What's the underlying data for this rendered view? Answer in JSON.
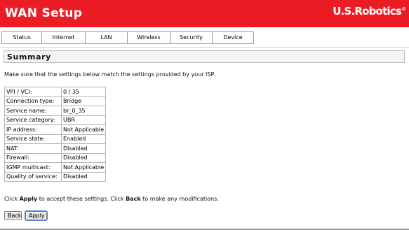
{
  "header": {
    "title": "WAN Setup",
    "brand": "U.S.Robotics",
    "brand_mark": "®",
    "background_color": "#ec1c24"
  },
  "nav": {
    "tabs": [
      "Status",
      "Internet",
      "LAN",
      "Wireless",
      "Security",
      "Device"
    ]
  },
  "section": {
    "title": "Summary"
  },
  "intro_text": "Make sure that the settings below match the settings provided by your ISP.",
  "settings": [
    {
      "label": "VPI / VCI:",
      "value": "0 / 35"
    },
    {
      "label": "Connection type:",
      "value": "Bridge"
    },
    {
      "label": "Service name:",
      "value": "br_0_35"
    },
    {
      "label": "Service category:",
      "value": "UBR"
    },
    {
      "label": "IP address:",
      "value": "Not Applicable"
    },
    {
      "label": "Service state:",
      "value": "Enabled"
    },
    {
      "label": "NAT:",
      "value": "Disabled"
    },
    {
      "label": "Firewall:",
      "value": "Disabled"
    },
    {
      "label": "IGMP multicast:",
      "value": "Not Applicable"
    },
    {
      "label": "Quality of service:",
      "value": "Disabled"
    }
  ],
  "apply_note": {
    "part1": "Click ",
    "apply_word": "Apply",
    "part2": " to accept these settings. Click ",
    "back_word": "Back",
    "part3": " to make any modifications."
  },
  "buttons": {
    "back_label": "Back",
    "apply_label": "Apply"
  }
}
